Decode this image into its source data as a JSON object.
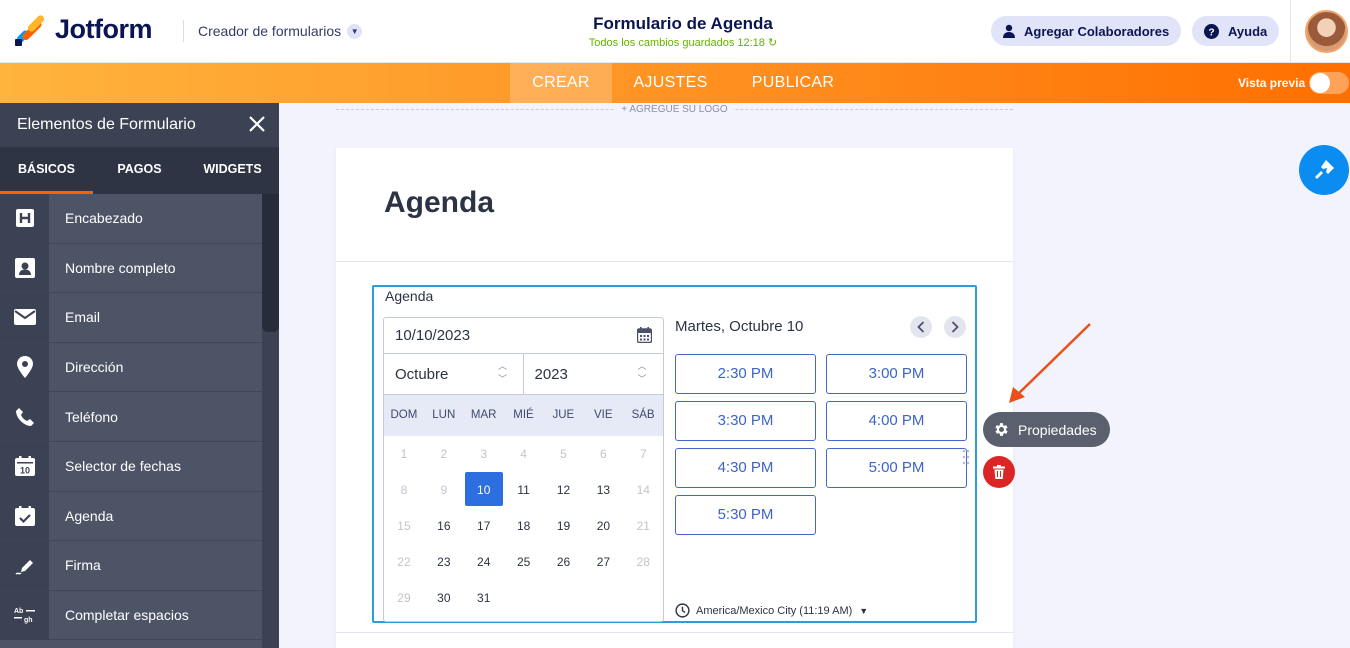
{
  "header": {
    "brand": "Jotform",
    "builder_label": "Creador de formularios",
    "form_title": "Formulario de Agenda",
    "saved_status": "Todos los cambios guardados 12:18 ↻",
    "collaborators_label": "Agregar Colaboradores",
    "help_label": "Ayuda"
  },
  "nav": {
    "tabs": [
      {
        "label": "CREAR",
        "active": true
      },
      {
        "label": "AJUSTES",
        "active": false
      },
      {
        "label": "PUBLICAR",
        "active": false
      }
    ],
    "preview_label": "Vista previa",
    "preview_on": false
  },
  "panel": {
    "title": "Elementos de Formulario",
    "tabs": [
      "BÁSICOS",
      "PAGOS",
      "WIDGETS"
    ],
    "active_tab": "BÁSICOS",
    "items": [
      {
        "label": "Encabezado",
        "icon": "heading-icon"
      },
      {
        "label": "Nombre completo",
        "icon": "contact-card-icon"
      },
      {
        "label": "Email",
        "icon": "envelope-icon"
      },
      {
        "label": "Dirección",
        "icon": "map-pin-icon"
      },
      {
        "label": "Teléfono",
        "icon": "phone-icon"
      },
      {
        "label": "Selector de fechas",
        "icon": "calendar-date-icon"
      },
      {
        "label": "Agenda",
        "icon": "calendar-check-icon"
      },
      {
        "label": "Firma",
        "icon": "pen-signature-icon"
      },
      {
        "label": "Completar espacios",
        "icon": "fill-blank-icon"
      }
    ]
  },
  "form": {
    "add_logo": "+ AGREGUE SU LOGO",
    "heading": "Agenda",
    "field_label": "Agenda",
    "date_value": "10/10/2023",
    "month": "Octubre",
    "year": "2023",
    "weekdays": [
      "DOM",
      "LUN",
      "MAR",
      "MIÉ",
      "JUE",
      "VIE",
      "SÁB"
    ],
    "weeks": [
      [
        {
          "d": "1",
          "s": "out"
        },
        {
          "d": "2",
          "s": "out"
        },
        {
          "d": "3",
          "s": "out"
        },
        {
          "d": "4",
          "s": "out"
        },
        {
          "d": "5",
          "s": "out"
        },
        {
          "d": "6",
          "s": "out"
        },
        {
          "d": "7",
          "s": "out"
        }
      ],
      [
        {
          "d": "8",
          "s": "out"
        },
        {
          "d": "9",
          "s": "out"
        },
        {
          "d": "10",
          "s": "sel"
        },
        {
          "d": "11",
          "s": ""
        },
        {
          "d": "12",
          "s": ""
        },
        {
          "d": "13",
          "s": ""
        },
        {
          "d": "14",
          "s": "out"
        }
      ],
      [
        {
          "d": "15",
          "s": "out"
        },
        {
          "d": "16",
          "s": ""
        },
        {
          "d": "17",
          "s": ""
        },
        {
          "d": "18",
          "s": ""
        },
        {
          "d": "19",
          "s": ""
        },
        {
          "d": "20",
          "s": ""
        },
        {
          "d": "21",
          "s": "out"
        }
      ],
      [
        {
          "d": "22",
          "s": "out"
        },
        {
          "d": "23",
          "s": ""
        },
        {
          "d": "24",
          "s": ""
        },
        {
          "d": "25",
          "s": ""
        },
        {
          "d": "26",
          "s": ""
        },
        {
          "d": "27",
          "s": ""
        },
        {
          "d": "28",
          "s": "out"
        }
      ],
      [
        {
          "d": "29",
          "s": "out"
        },
        {
          "d": "30",
          "s": ""
        },
        {
          "d": "31",
          "s": ""
        },
        {
          "d": "",
          "s": "empty"
        },
        {
          "d": "",
          "s": "empty"
        },
        {
          "d": "",
          "s": "empty"
        },
        {
          "d": "",
          "s": "empty"
        }
      ]
    ],
    "slots_heading": "Martes, Octubre 10",
    "slots": [
      "2:30 PM",
      "3:00 PM",
      "3:30 PM",
      "4:00 PM",
      "4:30 PM",
      "5:00 PM",
      "5:30 PM"
    ],
    "timezone": "America/Mexico City (11:19 AM)"
  },
  "actions": {
    "properties_label": "Propiedades"
  },
  "colors": {
    "accent_orange": "#ff6100",
    "field_focus": "#2d9cdb",
    "slot_blue": "#3d64c6",
    "delete_red": "#dc2626",
    "saved_green": "#64b200"
  }
}
